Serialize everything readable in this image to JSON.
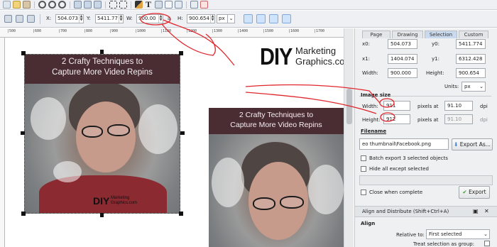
{
  "toolbar": {
    "x_label": "X:",
    "x_value": "504.073",
    "y_label": "Y:",
    "y_value": "5411.77",
    "w_label": "W:",
    "w_value": "900.00",
    "h_label": "H:",
    "h_value": "900.654",
    "unit": "px",
    "lock_label": "a"
  },
  "ruler": {
    "ticks": [
      "|500",
      "|600",
      "|700",
      "|800",
      "|900",
      "|1000",
      "|1100",
      "|1200",
      "|1300",
      "|1400",
      "|1500",
      "|1600",
      "|1700"
    ]
  },
  "canvas": {
    "banner_line1": "2 Crafty Techniques to",
    "banner_line2": "Capture More Video Repins",
    "logo_big": "DIY",
    "logo_line1": "Marketing",
    "logo_line2": "Graphics.com",
    "mini_logo_big": "DIY",
    "mini_logo_line1": "Marketing",
    "mini_logo_line2": "Graphics.com"
  },
  "panel": {
    "tabs": [
      "Page",
      "Drawing",
      "Selection",
      "Custom"
    ],
    "x0_label": "x0:",
    "x0_value": "504.073",
    "y0_label": "y0:",
    "y0_value": "5411.774",
    "x1_label": "x1:",
    "x1_value": "1404.074",
    "y1_label": "y1:",
    "y1_value": "6312.428",
    "width_label": "Width:",
    "width_value": "900.000",
    "height_label": "Height:",
    "height_value": "900.654",
    "units_label": "Units:",
    "units_value": "px",
    "image_size_title": "Image size",
    "img_width_label": "Width:",
    "img_width_value": "911",
    "img_height_label": "Height:",
    "img_height_value": "912",
    "pixels_at": "pixels at",
    "dpi_width": "91.10",
    "dpi_height": "91.10",
    "dpi_label": "dpi",
    "filename_title": "Filename",
    "filename_value": "eo thumbnail\\Facebook.png",
    "export_as_label": "Export As...",
    "batch_label": "Batch export 3 selected objects",
    "hide_label": "Hide all except selected",
    "close_label": "Close when complete",
    "export_label": "Export",
    "align_header": "Align and Distribute (Shift+Ctrl+A)",
    "align_title": "Align",
    "relative_label": "Relative to:",
    "relative_value": "First selected",
    "treat_label": "Treat selection as group:"
  },
  "colors": {
    "banner": "#4a2c33",
    "annotation": "#e0262c",
    "accent": "#7ea9dd"
  }
}
